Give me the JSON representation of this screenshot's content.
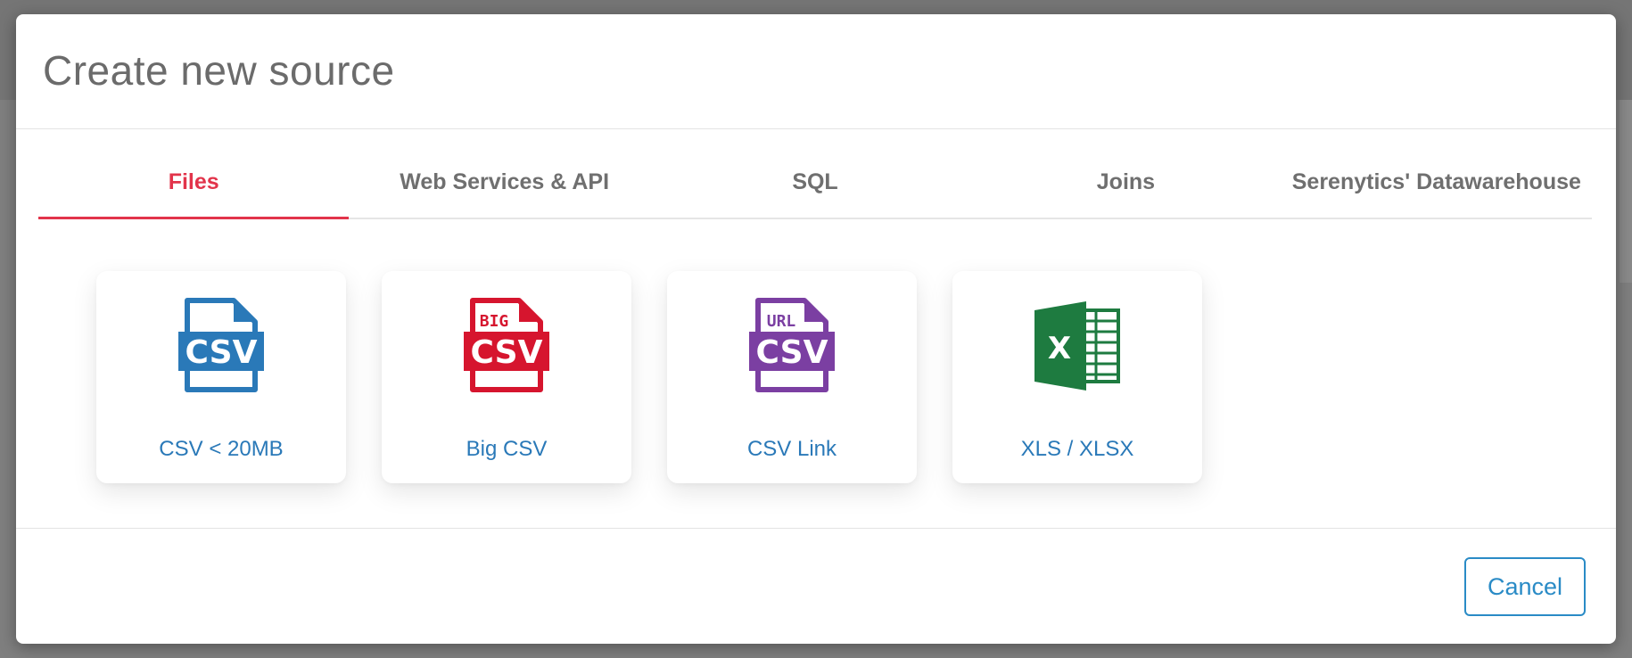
{
  "modal": {
    "title": "Create new source"
  },
  "tabs": [
    {
      "label": "Files",
      "active": true
    },
    {
      "label": "Web Services & API",
      "active": false
    },
    {
      "label": "SQL",
      "active": false
    },
    {
      "label": "Joins",
      "active": false
    },
    {
      "label": "Serenytics' Datawarehouse",
      "active": false
    }
  ],
  "cards": [
    {
      "label": "CSV < 20MB",
      "icon": "csv-file-icon",
      "color": "#2a79b8",
      "badge": ""
    },
    {
      "label": "Big CSV",
      "icon": "big-csv-file-icon",
      "color": "#d6152e",
      "badge": "BIG"
    },
    {
      "label": "CSV Link",
      "icon": "url-csv-file-icon",
      "color": "#7b3fa2",
      "badge": "URL"
    },
    {
      "label": "XLS / XLSX",
      "icon": "excel-icon",
      "color": "#1e7b40",
      "badge": ""
    }
  ],
  "icon_text": {
    "csv": "CSV",
    "excel": "X"
  },
  "footer": {
    "cancel_label": "Cancel"
  },
  "colors": {
    "active_tab": "#e2344b",
    "link": "#2a79b8",
    "button": "#2a8bc6"
  }
}
